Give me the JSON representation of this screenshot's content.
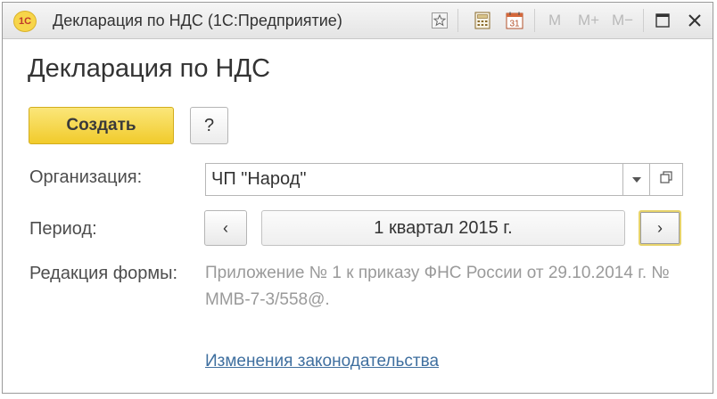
{
  "window": {
    "title": "Декларация по НДС  (1С:Предприятие)",
    "app_logo": "1С",
    "toolbar": {
      "icons": [
        "favorite-star-icon",
        "calculator-icon",
        "calendar-icon"
      ],
      "calendar_day": "31",
      "memory": [
        "M",
        "M+",
        "M−"
      ],
      "window_icons": [
        "maximize-icon",
        "close-icon"
      ]
    }
  },
  "form": {
    "heading": "Декларация по НДС",
    "create_label": "Создать",
    "help_label": "?",
    "organization": {
      "label": "Организация:",
      "value": "ЧП \"Народ\""
    },
    "period": {
      "label": "Период:",
      "prev_label": "‹",
      "value": "1 квартал 2015 г.",
      "next_label": "›"
    },
    "edition": {
      "label": "Редакция формы:",
      "value": "Приложение № 1 к приказу ФНС России от 29.10.2014 г. № ММВ-7-3/558@."
    },
    "legislation_link": "Изменения законодательства"
  },
  "colors": {
    "accent_yellow": "#f1cb2b",
    "link_blue": "#3f6f9f",
    "muted_text": "#9a9a9a"
  }
}
